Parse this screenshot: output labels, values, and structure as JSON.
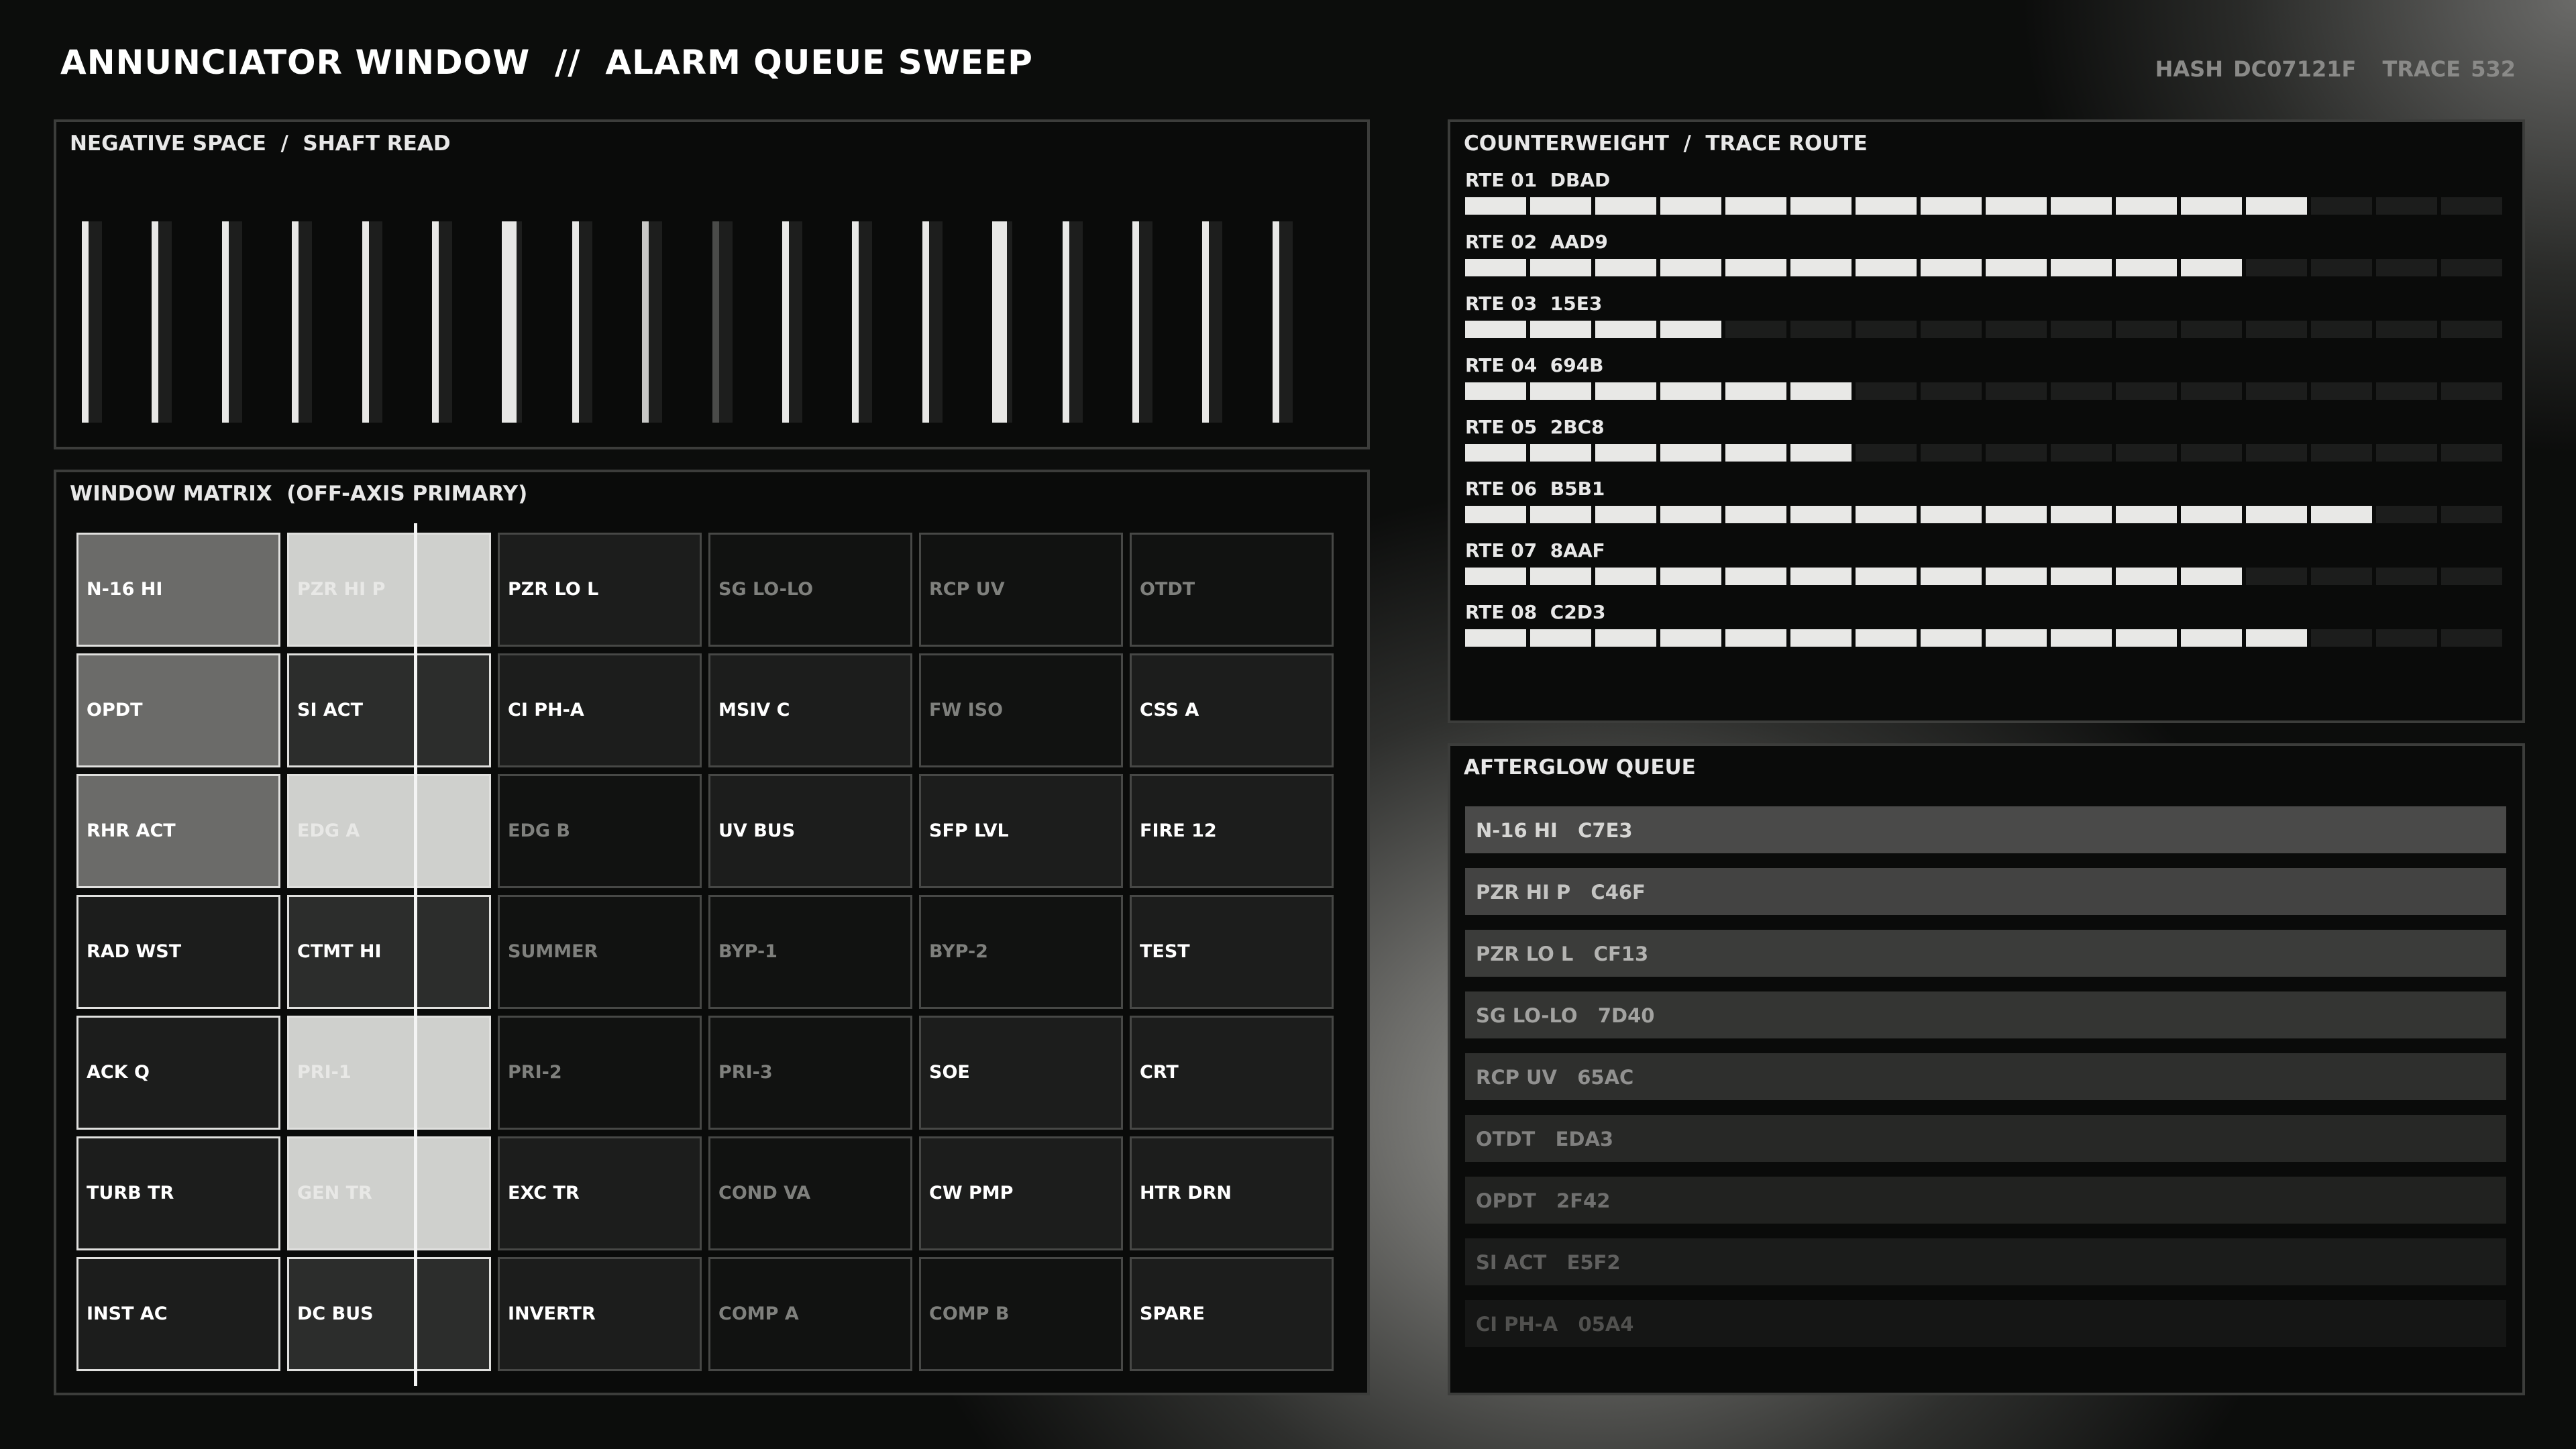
{
  "header": {
    "title": "ANNUNCIATOR WINDOW  //  ALARM QUEUE SWEEP",
    "hash": "HASH DC07121F",
    "trace": "TRACE 532"
  },
  "shaft": {
    "title": "NEGATIVE SPACE  /  SHAFT READ",
    "bars": [
      {
        "level": "high"
      },
      {
        "level": "high"
      },
      {
        "level": "high"
      },
      {
        "level": "high"
      },
      {
        "level": "high"
      },
      {
        "level": "high"
      },
      {
        "level": "high"
      },
      {
        "level": "high"
      },
      {
        "level": "mid"
      },
      {
        "level": "low"
      },
      {
        "level": "high"
      },
      {
        "level": "high"
      },
      {
        "level": "high"
      },
      {
        "level": "high"
      },
      {
        "level": "high"
      },
      {
        "level": "high"
      },
      {
        "level": "high"
      },
      {
        "level": "high"
      }
    ]
  },
  "matrix": {
    "title": "WINDOW MATRIX  (OFF-AXIS PRIMARY)",
    "cells": [
      {
        "label": "N-16 HI",
        "state": "lit"
      },
      {
        "label": "PZR HI P",
        "state": "flash"
      },
      {
        "label": "PZR LO L",
        "state": "alarm"
      },
      {
        "label": "SG LO-LO",
        "state": "dim"
      },
      {
        "label": "RCP UV",
        "state": "dim"
      },
      {
        "label": "OTDT",
        "state": "dim"
      },
      {
        "label": "OPDT",
        "state": "lit"
      },
      {
        "label": "SI ACT",
        "state": "ack"
      },
      {
        "label": "CI PH-A",
        "state": "alarm"
      },
      {
        "label": "MSIV C",
        "state": "alarm"
      },
      {
        "label": "FW ISO",
        "state": "dim"
      },
      {
        "label": "CSS A",
        "state": "alarm"
      },
      {
        "label": "RHR ACT",
        "state": "lit"
      },
      {
        "label": "EDG A",
        "state": "flash"
      },
      {
        "label": "EDG B",
        "state": "dim"
      },
      {
        "label": "UV BUS",
        "state": "alarm"
      },
      {
        "label": "SFP LVL",
        "state": "alarm"
      },
      {
        "label": "FIRE 12",
        "state": "alarm"
      },
      {
        "label": "RAD WST",
        "state": "alarm-strong"
      },
      {
        "label": "CTMT HI",
        "state": "ack"
      },
      {
        "label": "SUMMER",
        "state": "dim"
      },
      {
        "label": "BYP-1",
        "state": "dim"
      },
      {
        "label": "BYP-2",
        "state": "dim"
      },
      {
        "label": "TEST",
        "state": "alarm"
      },
      {
        "label": "ACK Q",
        "state": "alarm-strong"
      },
      {
        "label": "PRI-1",
        "state": "flash"
      },
      {
        "label": "PRI-2",
        "state": "dim"
      },
      {
        "label": "PRI-3",
        "state": "dim"
      },
      {
        "label": "SOE",
        "state": "alarm"
      },
      {
        "label": "CRT",
        "state": "alarm"
      },
      {
        "label": "TURB TR",
        "state": "alarm-strong"
      },
      {
        "label": "GEN TR",
        "state": "flash"
      },
      {
        "label": "EXC TR",
        "state": "alarm"
      },
      {
        "label": "COND VA",
        "state": "dim"
      },
      {
        "label": "CW PMP",
        "state": "alarm"
      },
      {
        "label": "HTR DRN",
        "state": "alarm"
      },
      {
        "label": "INST AC",
        "state": "alarm-strong"
      },
      {
        "label": "DC BUS",
        "state": "ack"
      },
      {
        "label": "INVERTR",
        "state": "alarm"
      },
      {
        "label": "COMP A",
        "state": "dim"
      },
      {
        "label": "COMP B",
        "state": "dim"
      },
      {
        "label": "SPARE",
        "state": "alarm"
      }
    ]
  },
  "trace": {
    "title": "COUNTERWEIGHT  /  TRACE ROUTE",
    "total_segments": 16,
    "routes": [
      {
        "label": "RTE 01  DBAD",
        "filled": 13
      },
      {
        "label": "RTE 02  AAD9",
        "filled": 12
      },
      {
        "label": "RTE 03  15E3",
        "filled": 4
      },
      {
        "label": "RTE 04  694B",
        "filled": 6
      },
      {
        "label": "RTE 05  2BC8",
        "filled": 6
      },
      {
        "label": "RTE 06  B5B1",
        "filled": 14
      },
      {
        "label": "RTE 07  8AAF",
        "filled": 12
      },
      {
        "label": "RTE 08  C2D3",
        "filled": 13
      }
    ]
  },
  "afterglow": {
    "title": "AFTERGLOW QUEUE",
    "items": [
      {
        "text": "N-16 HI   C7E3",
        "bg": "#4a4a49",
        "fg": "#d6d6d4"
      },
      {
        "text": "PZR HI P   C46F",
        "bg": "#434342",
        "fg": "#c4c4c2"
      },
      {
        "text": "PZR LO L   CF13",
        "bg": "#3b3c3a",
        "fg": "#b3b3b1"
      },
      {
        "text": "SG LO-LO   7D40",
        "bg": "#343533",
        "fg": "#a2a2a0"
      },
      {
        "text": "RCP UV   65AC",
        "bg": "#2e2f2d",
        "fg": "#919190"
      },
      {
        "text": "OTDT   EDA3",
        "bg": "#272826",
        "fg": "#80807f"
      },
      {
        "text": "OPDT   2F42",
        "bg": "#212220",
        "fg": "#70706f"
      },
      {
        "text": "SI ACT   E5F2",
        "bg": "#1b1c1b",
        "fg": "#60605f"
      },
      {
        "text": "CI PH-A   05A4",
        "bg": "#151615",
        "fg": "#51514f"
      }
    ]
  }
}
